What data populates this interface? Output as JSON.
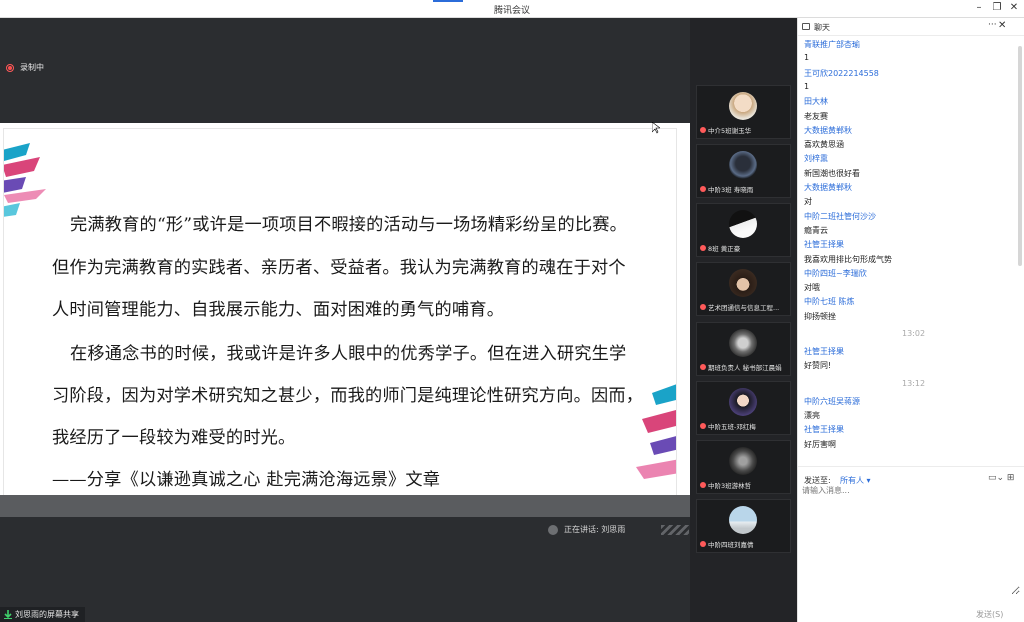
{
  "window": {
    "title": "腾讯会议"
  },
  "stage": {
    "recording_label": "录制中",
    "speaker_label": "正在讲话: 刘思雨",
    "sharing_label": "刘思雨的屏幕共享"
  },
  "slide": {
    "lines": [
      "完满教育的“形”或许是一项项目不暇接的活动与一场场精彩纷呈的比赛。",
      "但作为完满教育的实践者、亲历者、受益者。我认为完满教育的魂在于对个",
      "人时间管理能力、自我展示能力、面对困难的勇气的哺育。",
      "在移通念书的时候，我或许是许多人眼中的优秀学子。但在进入研究生学",
      "习阶段，因为对学术研究知之甚少，而我的师门是纯理论性研究方向。因而，",
      "我经历了一段较为难受的时光。",
      "——分享《以谦逊真诚之心  赴完满沧海远景》文章"
    ]
  },
  "participants": [
    {
      "name": "中介5班谢玉华"
    },
    {
      "name": "中阶3班 寿晓雨"
    },
    {
      "name": "8班 黄正豪"
    },
    {
      "name": "艺术团通信与信息工程..."
    },
    {
      "name": "期班负责人 秘书部江晨娟"
    },
    {
      "name": "中阶五班-邓红梅"
    },
    {
      "name": "中阶3班游林哲"
    },
    {
      "name": "中阶四班刘嘉倩"
    }
  ],
  "chat": {
    "title": "聊天",
    "more": "···",
    "close": "✕",
    "messages": [
      {
        "kind": "name",
        "text": "青联推广部杏瑜"
      },
      {
        "kind": "text",
        "text": "1"
      },
      {
        "kind": "name",
        "text": "王可欣2022214558"
      },
      {
        "kind": "text",
        "text": "1"
      },
      {
        "kind": "name",
        "text": "田大林"
      },
      {
        "kind": "text",
        "text": "老友赛"
      },
      {
        "kind": "name",
        "text": "大数据黄郸秋"
      },
      {
        "kind": "text",
        "text": "喜欢黄思涵"
      },
      {
        "kind": "name",
        "text": "刘梓熏"
      },
      {
        "kind": "text",
        "text": "新国潮也很好看"
      },
      {
        "kind": "name",
        "text": "大数据黄郸秋"
      },
      {
        "kind": "text",
        "text": "对"
      },
      {
        "kind": "name",
        "text": "中阶二班社管何沙沙"
      },
      {
        "kind": "text",
        "text": "瘾青云"
      },
      {
        "kind": "name",
        "text": "社管王择果"
      },
      {
        "kind": "text",
        "text": "我喜欢用排比句形成气势"
      },
      {
        "kind": "name",
        "text": "中阶四班~李瑞欣"
      },
      {
        "kind": "text",
        "text": "对哦"
      },
      {
        "kind": "name",
        "text": "中阶七班 陈炼"
      },
      {
        "kind": "text",
        "text": "抑扬顿挫"
      },
      {
        "kind": "time",
        "text": "13:02"
      },
      {
        "kind": "name",
        "text": "社管王择果"
      },
      {
        "kind": "text",
        "text": "好赞同!"
      },
      {
        "kind": "time",
        "text": "13:12"
      },
      {
        "kind": "name",
        "text": "中阶六班吴蒋源"
      },
      {
        "kind": "text",
        "text": "漂亮"
      },
      {
        "kind": "name",
        "text": "社管王择果"
      },
      {
        "kind": "text",
        "text": "好厉害啊"
      }
    ],
    "send_to_label": "发送至:",
    "send_to_value": "所有人 ▾",
    "input_placeholder": "请输入消息...",
    "send_button": "发送(S)",
    "tools": "▭⌄ ⊞"
  }
}
